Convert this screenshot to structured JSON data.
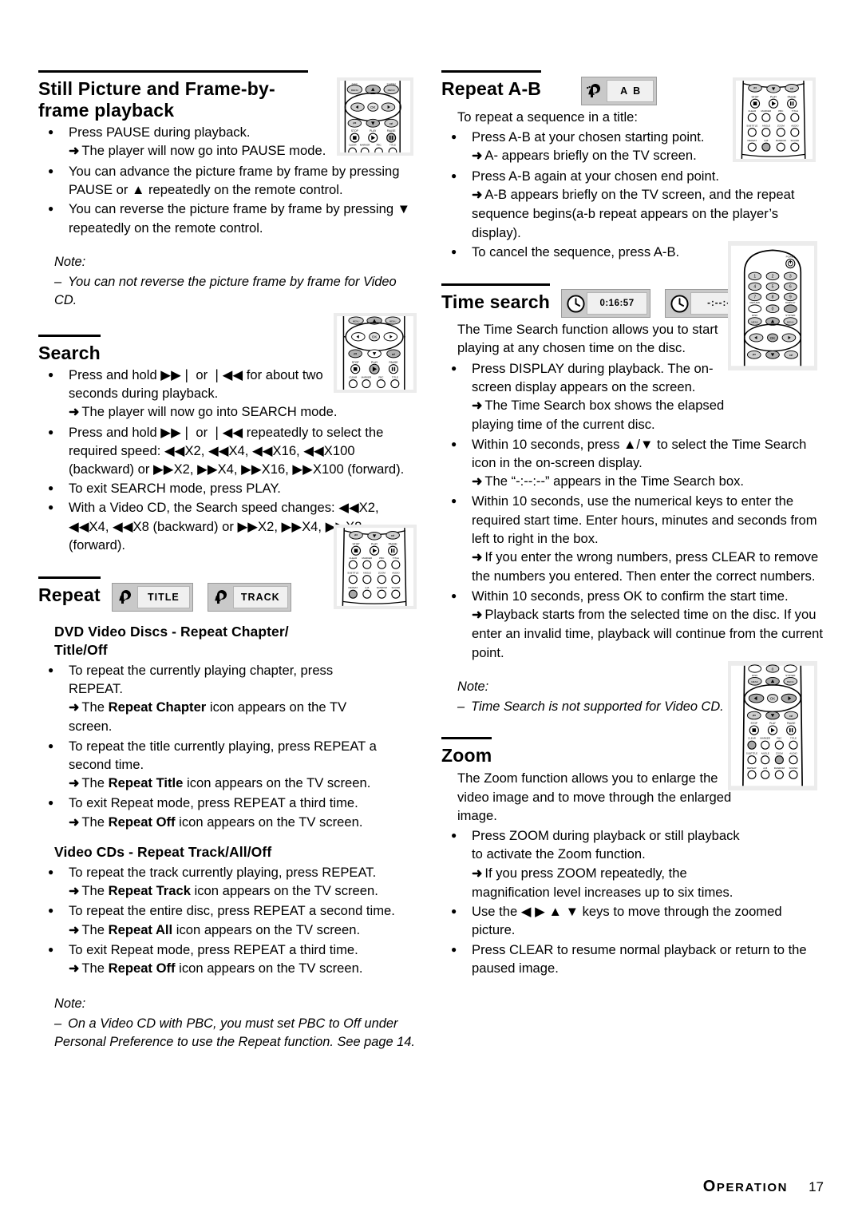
{
  "document": {
    "footer": {
      "section_label": "OPERATION",
      "section_label_first": "O",
      "section_label_rest": "PERATION",
      "page_number": "17"
    }
  },
  "left_column": {
    "section_still": {
      "heading": "Still Picture and Frame-by-frame playback",
      "bullets": [
        {
          "text": "Press PAUSE during playback.",
          "arrow": "The player will now go into PAUSE mode."
        },
        {
          "text": "You can advance the picture frame by frame by pressing PAUSE or ▲ repeatedly on the remote control."
        },
        {
          "text": "You can reverse the picture frame by frame by pressing ▼ repeatedly on the remote control."
        }
      ],
      "note_title": "Note:",
      "note_items": [
        "You can not reverse the picture frame by frame for Video CD."
      ]
    },
    "section_search": {
      "heading": "Search",
      "bullets": [
        {
          "text": "Press and hold ▶▶❘ or ❘◀◀ for about two seconds during playback.",
          "arrow": "The player will now go into SEARCH mode."
        },
        {
          "text": "Press and hold ▶▶❘ or ❘◀◀ repeatedly to select the required speed: ◀◀X2, ◀◀X4, ◀◀X16, ◀◀X100 (backward) or ▶▶X2, ▶▶X4, ▶▶X16, ▶▶X100 (forward)."
        },
        {
          "text": "To exit SEARCH mode, press PLAY."
        },
        {
          "text": "With a Video CD, the Search speed changes: ◀◀X2, ◀◀X4, ◀◀X8 (backward) or ▶▶X2, ▶▶X4, ▶▶X8 (forward)."
        }
      ]
    },
    "section_repeat": {
      "heading": "Repeat",
      "badges": [
        {
          "icon": "repeat-icon",
          "label": "TITLE"
        },
        {
          "icon": "repeat-icon",
          "label": "TRACK"
        }
      ],
      "subhead_dvd": "DVD Video Discs - Repeat Chapter/ Title/Off",
      "dvd_bullets": [
        {
          "text": "To repeat the currently playing chapter, press REPEAT.",
          "arrow_pre": "The ",
          "arrow_bold": "Repeat Chapter",
          "arrow_post": " icon appears on the TV screen."
        },
        {
          "text": "To repeat the title currently playing, press REPEAT a second time.",
          "arrow_pre": "The ",
          "arrow_bold": "Repeat Title",
          "arrow_post": " icon appears on the TV screen."
        },
        {
          "text": "To exit Repeat mode, press REPEAT a third time.",
          "arrow_pre": "The ",
          "arrow_bold": "Repeat Off",
          "arrow_post": " icon appears on the TV screen."
        }
      ],
      "subhead_vcd": "Video CDs - Repeat Track/All/Off",
      "vcd_bullets": [
        {
          "text": "To repeat the track currently playing, press REPEAT.",
          "arrow_pre": "The ",
          "arrow_bold": "Repeat Track",
          "arrow_post": " icon appears on the TV screen."
        },
        {
          "text": "To repeat the entire disc, press REPEAT a second time.",
          "arrow_pre": "The ",
          "arrow_bold": "Repeat All",
          "arrow_post": " icon appears on the TV screen."
        },
        {
          "text": "To exit Repeat mode, press REPEAT a third time.",
          "arrow_pre": "The ",
          "arrow_bold": "Repeat Off",
          "arrow_post": " icon appears on the TV screen."
        }
      ],
      "note_title": "Note:",
      "note_items": [
        "On a Video CD with PBC, you must set PBC to Off under Personal Preference to use the Repeat function. See page 14."
      ]
    }
  },
  "right_column": {
    "section_ab": {
      "heading": "Repeat A-B",
      "badge": {
        "icon": "repeat-ab-icon",
        "label_a": "A",
        "label_b": "B"
      },
      "intro": "To repeat a sequence in a title:",
      "bullets": [
        {
          "text": "Press A-B at your chosen starting point.",
          "arrow": "A- appears briefly on the TV screen."
        },
        {
          "text": "Press A-B again at your chosen end point.",
          "arrow": "A-B appears briefly on the TV screen, and the repeat sequence begins(a-b repeat appears on the player’s display)."
        },
        {
          "text": "To cancel the sequence, press A-B."
        }
      ]
    },
    "section_time": {
      "heading": "Time search",
      "badges": [
        {
          "icon": "clock-icon",
          "label": "0:16:57"
        },
        {
          "icon": "clock-icon",
          "label": "-:--:--"
        }
      ],
      "intro": "The Time Search function allows you to start playing at any chosen time on the disc.",
      "bullets": [
        {
          "text": "Press DISPLAY during playback. The on-screen display appears on the screen.",
          "arrow": "The Time Search box shows the elapsed playing time of the current disc."
        },
        {
          "text": "Within 10 seconds, press ▲/▼ to select the Time Search icon in the on-screen display.",
          "arrow": "The “-:--:--” appears in the Time Search box."
        },
        {
          "text": "Within 10 seconds, use the numerical keys to enter the required start time. Enter hours, minutes and seconds from left to right in the box.",
          "arrow": "If you enter the wrong numbers, press CLEAR to remove the numbers you entered. Then enter the correct numbers."
        },
        {
          "text": "Within 10 seconds, press OK to confirm the start time.",
          "arrow": "Playback starts from the selected time on the disc. If you enter an invalid time, playback will continue from the current point."
        }
      ],
      "note_title": "Note:",
      "note_items": [
        "Time Search is not supported for Video CD."
      ]
    },
    "section_zoom": {
      "heading": "Zoom",
      "intro": "The Zoom function allows you to enlarge the video image and to move through the enlarged image.",
      "bullets": [
        {
          "text": "Press ZOOM during playback or still playback to activate the Zoom function.",
          "arrow": "If you press ZOOM repeatedly, the magnification level increases up to six times."
        },
        {
          "text": "Use the ◀ ▶ ▲ ▼ keys to move through the zoomed picture."
        },
        {
          "text": "Press CLEAR to resume normal playback or return to the paused image."
        }
      ]
    }
  },
  "remotes": {
    "labels": {
      "disc_menu": "DISC MENU",
      "system_menu": "SYSTEM MENU",
      "ok": "OK",
      "stop": "STOP",
      "play": "PLAY",
      "pause": "PAUSE",
      "clear": "CLEAR",
      "marker": "MARKER",
      "pbc": "PBC",
      "title": "TITLE",
      "subtitle": "SUBTITLE",
      "angle": "ANGLE",
      "zoom": "ZOOM",
      "audio": "AUDIO",
      "repeat": "REPEAT",
      "ab": "A-B",
      "random": "RANDOM",
      "sound": "SOUND",
      "power": "POWER",
      "return": "RETURN",
      "display": "DISPLAY",
      "digits": [
        "1",
        "2",
        "3",
        "4",
        "5",
        "6",
        "7",
        "8",
        "9",
        "0"
      ]
    }
  }
}
